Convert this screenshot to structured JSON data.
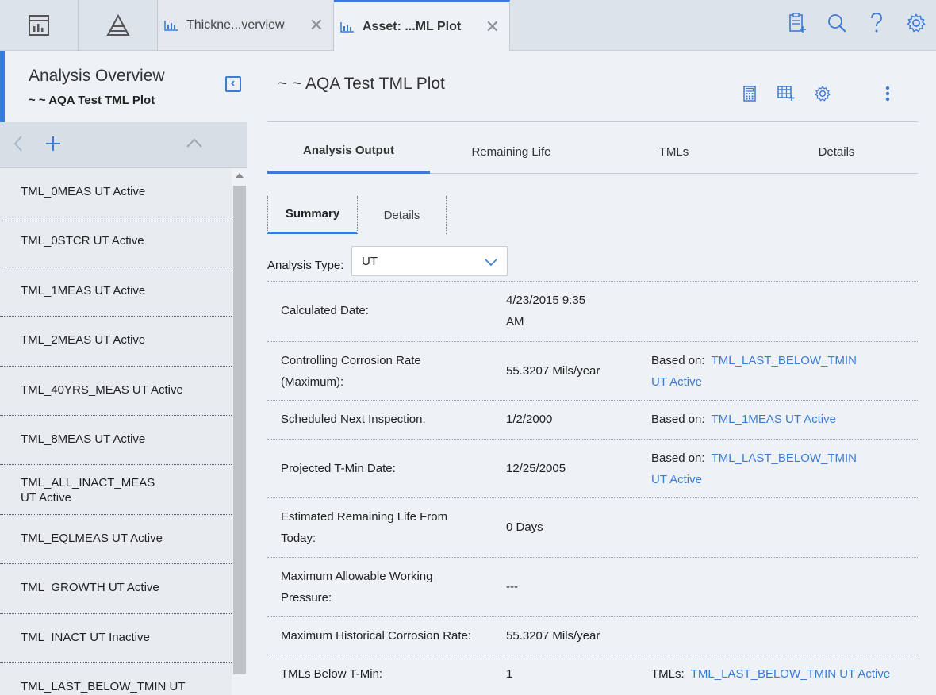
{
  "topbar": {
    "tabs": [
      {
        "label": "Thickne...verview",
        "close": "✕"
      },
      {
        "label": "Asset: ...ML Plot",
        "close": "✕"
      }
    ],
    "icons": [
      "dashboard-icon",
      "hierarchy-icon",
      "clipboard-add-icon",
      "search-icon",
      "help-icon",
      "settings-icon"
    ]
  },
  "sidebar": {
    "title": "Analysis Overview",
    "subtitle": "~ ~ AQA Test TML Plot",
    "toolbar": {
      "back": "‹",
      "add": "+",
      "collapse_up": "⌃"
    },
    "items": [
      {
        "label": "TML_0MEAS UT Active"
      },
      {
        "label": "TML_0STCR UT Active"
      },
      {
        "label": "TML_1MEAS UT Active"
      },
      {
        "label": "TML_2MEAS UT Active"
      },
      {
        "label": "TML_40YRS_MEAS UT Active"
      },
      {
        "label": "TML_8MEAS UT Active"
      },
      {
        "label": "TML_ALL_INACT_MEAS UT Active"
      },
      {
        "label": "TML_EQLMEAS UT Active"
      },
      {
        "label": "TML_GROWTH UT Active"
      },
      {
        "label": "TML_INACT UT Inactive"
      },
      {
        "label": "TML_LAST_BELOW_TMIN UT"
      }
    ]
  },
  "main": {
    "title": "~ ~ AQA Test TML Plot",
    "tabs": [
      {
        "label": "Analysis Output"
      },
      {
        "label": "Remaining Life"
      },
      {
        "label": "TMLs"
      },
      {
        "label": "Details"
      }
    ],
    "subtabs": [
      {
        "label": "Summary"
      },
      {
        "label": "Details"
      }
    ],
    "analysis_type": {
      "label": "Analysis Type:",
      "value": "UT"
    },
    "rows": [
      {
        "label": "Calculated Date:",
        "value": "4/23/2015 9:35 AM",
        "based_prefix": "",
        "based_link": ""
      },
      {
        "label": "Controlling Corrosion Rate (Maximum):",
        "value": "55.3207 Mils/year",
        "based_prefix": "Based on:",
        "based_link": "TML_LAST_BELOW_TMIN UT Active"
      },
      {
        "label": "Scheduled Next Inspection:",
        "value": "1/2/2000",
        "based_prefix": "Based on:",
        "based_link": "TML_1MEAS UT Active"
      },
      {
        "label": "Projected T-Min Date:",
        "value": "12/25/2005",
        "based_prefix": "Based on:",
        "based_link": "TML_LAST_BELOW_TMIN UT Active"
      },
      {
        "label": "Estimated Remaining Life From Today:",
        "value": "0 Days",
        "based_prefix": "",
        "based_link": ""
      },
      {
        "label": "Maximum Allowable Working Pressure:",
        "value": "---",
        "based_prefix": "",
        "based_link": ""
      },
      {
        "label": "Maximum Historical Corrosion Rate:",
        "value": "55.3207 Mils/year",
        "based_prefix": "",
        "based_link": ""
      },
      {
        "label": "TMLs Below T-Min:",
        "value": "1",
        "based_prefix": "TMLs:",
        "based_link": "TML_LAST_BELOW_TMIN UT Active"
      }
    ]
  },
  "colors": {
    "accent": "#3a7bd5",
    "link": "#3a7bd5",
    "background": "#eef2f6"
  }
}
